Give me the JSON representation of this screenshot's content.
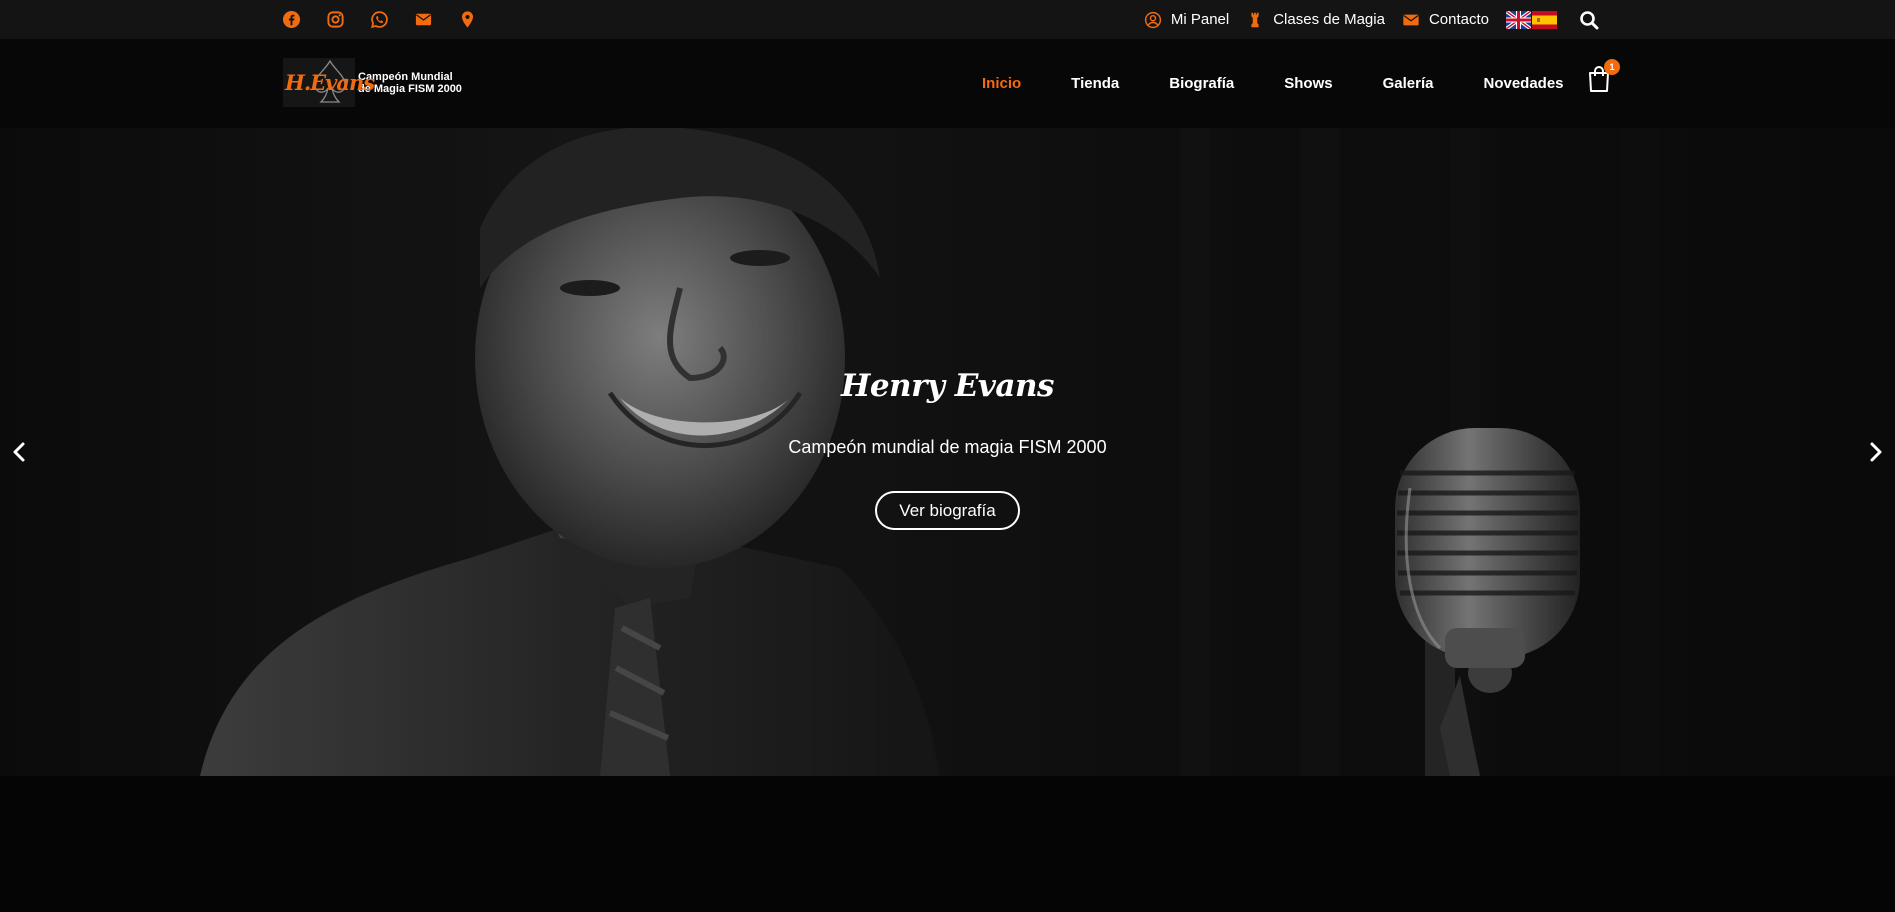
{
  "colors": {
    "accent": "#f26b0f",
    "topbar_bg": "#141414",
    "header_bg": "#070707",
    "page_bg": "#050505"
  },
  "topbar": {
    "social_icons": [
      "facebook-icon",
      "instagram-icon",
      "whatsapp-icon",
      "envelope-icon",
      "map-pin-icon"
    ],
    "links": {
      "panel": "Mi Panel",
      "classes": "Clases de Magia",
      "contact": "Contacto"
    },
    "link_icons": [
      "user-circle-icon",
      "chess-piece-icon",
      "envelope-icon"
    ],
    "flags": [
      "uk-flag-icon",
      "spain-flag-icon"
    ],
    "search_icon": "search-icon"
  },
  "header": {
    "logo": {
      "mark_text": "H.Evans",
      "claim_line1": "Campeón Mundial",
      "claim_line2": "de Magia FISM 2000"
    },
    "nav": [
      "Inicio",
      "Tienda",
      "Biografía",
      "Shows",
      "Galería",
      "Novedades"
    ],
    "active_nav": "Inicio",
    "cart": {
      "icon": "shopping-bag-icon",
      "count": "1"
    }
  },
  "hero": {
    "title": "Henry Evans",
    "subtitle": "Campeón mundial de magia FISM 2000",
    "button": "Ver biografía",
    "prev_icon": "chevron-left-icon",
    "next_icon": "chevron-right-icon"
  }
}
